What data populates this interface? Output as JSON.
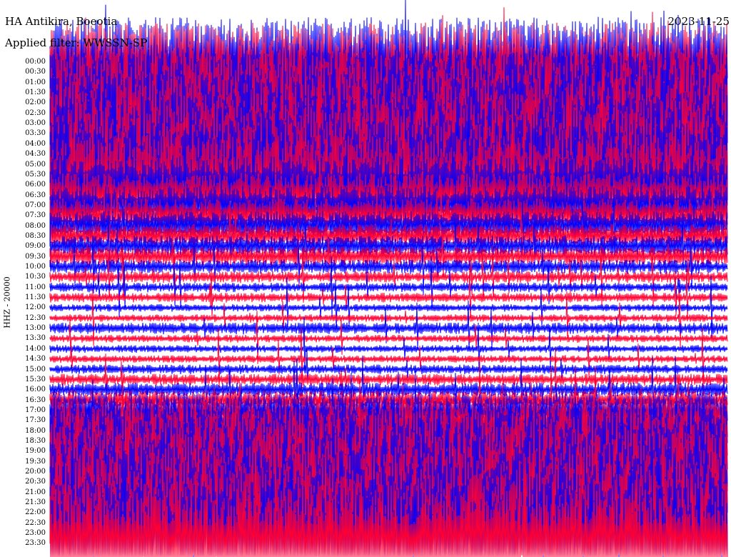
{
  "header": {
    "station": "HA Antikira, Boeotia",
    "filter": "Applied filter: WWSSN-SP",
    "date": "2023-11-25"
  },
  "chart_data": {
    "type": "line",
    "title": "HA Antikira, Boeotia",
    "subtitle": "Applied filter: WWSSN-SP",
    "date": "2023-11-25",
    "ylabel": "HHZ - 20000",
    "trace_colors": [
      "#0000ff",
      "#ff0033"
    ],
    "rows": [
      {
        "time": "00:00",
        "amplitude": 0.9
      },
      {
        "time": "00:30",
        "amplitude": 1.0
      },
      {
        "time": "01:00",
        "amplitude": 1.0
      },
      {
        "time": "01:30",
        "amplitude": 1.0
      },
      {
        "time": "02:00",
        "amplitude": 1.0
      },
      {
        "time": "02:30",
        "amplitude": 1.0
      },
      {
        "time": "03:00",
        "amplitude": 1.0
      },
      {
        "time": "03:30",
        "amplitude": 1.0
      },
      {
        "time": "04:00",
        "amplitude": 1.0
      },
      {
        "time": "04:30",
        "amplitude": 0.95
      },
      {
        "time": "05:00",
        "amplitude": 0.9
      },
      {
        "time": "05:30",
        "amplitude": 0.8
      },
      {
        "time": "06:00",
        "amplitude": 0.6
      },
      {
        "time": "06:30",
        "amplitude": 0.45
      },
      {
        "time": "07:00",
        "amplitude": 0.4
      },
      {
        "time": "07:30",
        "amplitude": 0.35
      },
      {
        "time": "08:00",
        "amplitude": 0.3
      },
      {
        "time": "08:30",
        "amplitude": 0.25
      },
      {
        "time": "09:00",
        "amplitude": 0.22
      },
      {
        "time": "09:30",
        "amplitude": 0.2
      },
      {
        "time": "10:00",
        "amplitude": 0.15
      },
      {
        "time": "10:30",
        "amplitude": 0.12
      },
      {
        "time": "11:00",
        "amplitude": 0.1
      },
      {
        "time": "11:30",
        "amplitude": 0.1
      },
      {
        "time": "12:00",
        "amplitude": 0.08
      },
      {
        "time": "12:30",
        "amplitude": 0.08
      },
      {
        "time": "13:00",
        "amplitude": 0.12
      },
      {
        "time": "13:30",
        "amplitude": 0.08
      },
      {
        "time": "14:00",
        "amplitude": 0.08
      },
      {
        "time": "14:30",
        "amplitude": 0.08
      },
      {
        "time": "15:00",
        "amplitude": 0.1
      },
      {
        "time": "15:30",
        "amplitude": 0.12
      },
      {
        "time": "16:00",
        "amplitude": 0.15
      },
      {
        "time": "16:30",
        "amplitude": 0.2
      },
      {
        "time": "17:00",
        "amplitude": 0.35
      },
      {
        "time": "17:30",
        "amplitude": 0.5
      },
      {
        "time": "18:00",
        "amplitude": 0.7
      },
      {
        "time": "18:30",
        "amplitude": 0.8
      },
      {
        "time": "19:00",
        "amplitude": 0.9
      },
      {
        "time": "19:30",
        "amplitude": 1.0
      },
      {
        "time": "20:00",
        "amplitude": 1.0
      },
      {
        "time": "20:30",
        "amplitude": 1.0
      },
      {
        "time": "21:00",
        "amplitude": 1.0
      },
      {
        "time": "21:30",
        "amplitude": 1.0
      },
      {
        "time": "22:00",
        "amplitude": 1.0
      },
      {
        "time": "22:30",
        "amplitude": 1.0
      },
      {
        "time": "23:00",
        "amplitude": 1.0
      },
      {
        "time": "23:30",
        "amplitude": 1.0
      }
    ]
  }
}
